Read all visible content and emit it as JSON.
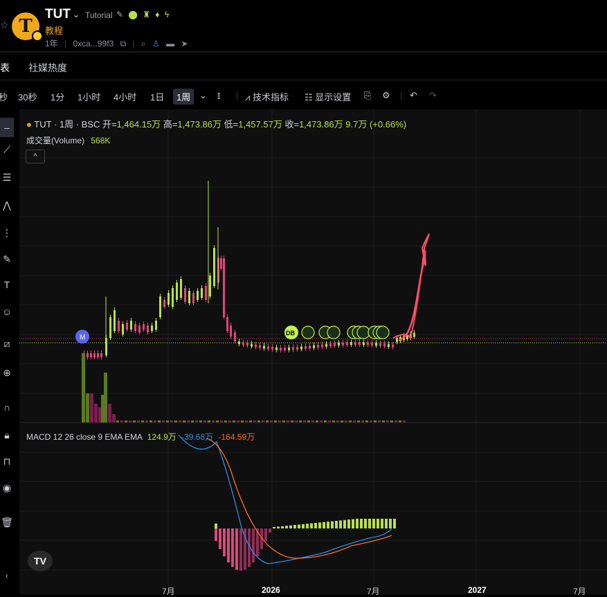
{
  "header": {
    "logo_letter": "T",
    "token_name": "TUT",
    "chevron": "⌄",
    "subtitle": "Tutorial",
    "icons": [
      "edit-icon",
      "badge-green-icon",
      "chef-icon",
      "moneybag-icon",
      "lightning-icon"
    ],
    "cn_name": "教程",
    "meta": {
      "age": "1年",
      "address": "0xca...99f3",
      "copy_icon": "copy-icon",
      "icons": [
        "search-icon",
        "user-icon",
        "card-icon",
        "telegram-icon"
      ]
    }
  },
  "tabs": {
    "chart": "图表",
    "social": "社媒热度"
  },
  "toolbar": {
    "intervals": [
      "秒",
      "30秒",
      "1分",
      "1小时",
      "4小时",
      "1日",
      "1周"
    ],
    "active_interval": "1周",
    "chart_type_icon": "candles-icon",
    "indicators": "技术指标",
    "display": "显示设置",
    "undo_icon": "undo-icon",
    "redo_icon": "redo-icon",
    "settings_icon": "gear-icon"
  },
  "legend": {
    "symbol": "TUT · 1周 · BSC",
    "open_label": "开=",
    "open": "1,464.15万",
    "high_label": "高=",
    "high": "1,473.86万",
    "low_label": "低=",
    "low": "1,457.57万",
    "close_label": "收=",
    "close": "1,473.86万",
    "change": "9.7万 (+0.66%)",
    "volume_label": "成交量(Volume)",
    "volume": "568K",
    "collapse": "^"
  },
  "macd": {
    "label": "MACD 12 26 close 9 EMA EMA",
    "hist": "124.9万",
    "macd": "-39.68万",
    "signal": "-164.59万"
  },
  "markers": {
    "m": "M",
    "db": "DB"
  },
  "xaxis": [
    "7月",
    "2026",
    "7月",
    "2027",
    "7月"
  ],
  "colors": {
    "up": "#b8e04a",
    "down": "#e0457b",
    "macd_line": "#2e8ee8",
    "signal_line": "#ff6d1f",
    "accent": "#f0a81a"
  }
}
